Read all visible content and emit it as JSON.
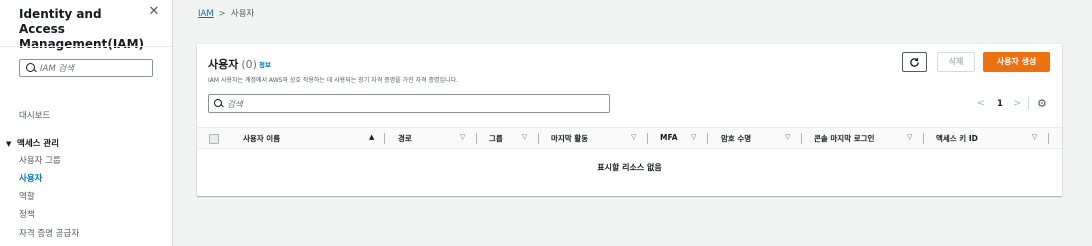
{
  "sidebar": {
    "title": "Identity and Access Management(IAM)",
    "close_icon": "close-icon",
    "search_placeholder": "IAM 검색",
    "dashboard": "대시보드",
    "access_management": "액세스 관리",
    "items": [
      {
        "label": "사용자 그룹",
        "active": false
      },
      {
        "label": "사용자",
        "active": true
      },
      {
        "label": "역할",
        "active": false
      },
      {
        "label": "정책",
        "active": false
      },
      {
        "label": "자격 증명 공급자",
        "active": false
      }
    ]
  },
  "breadcrumb": {
    "root": "IAM",
    "separator": ">",
    "current": "사용자"
  },
  "panel": {
    "title": "사용자",
    "count": "(0)",
    "info": "정보",
    "description": "IAM 사용자는 계정에서 AWS와 상호 작용하는 데 사용되는 장기 자격 증명을 가진 자격 증명입니다.",
    "refresh_icon": "refresh-icon",
    "delete_label": "삭제",
    "create_label": "사용자 생성",
    "search_placeholder": "검색",
    "page": "1",
    "prev": "<",
    "next": ">",
    "settings_icon": "gear-icon",
    "columns": [
      "사용자 이름",
      "경로",
      "그룹",
      "마지막 활동",
      "MFA",
      "암호 수명",
      "콘솔 마지막 로그인",
      "액세스 키 ID"
    ],
    "empty_message": "표시할 리소스 없음"
  },
  "colors": {
    "accent": "#0073bb",
    "primary_button": "#ec7211",
    "background": "#f2f3f3"
  }
}
